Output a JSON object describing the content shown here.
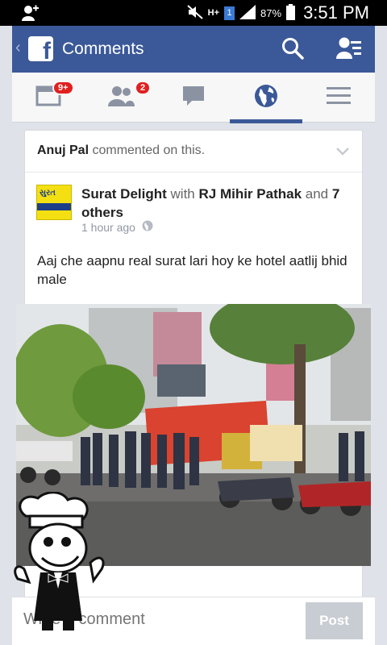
{
  "status_bar": {
    "network": "H+",
    "sim": "1",
    "battery": "87%",
    "time": "3:51 PM"
  },
  "app_bar": {
    "title": "Comments"
  },
  "tabs": [
    {
      "name": "feed",
      "badge": "9+"
    },
    {
      "name": "friend-requests",
      "badge": "2"
    },
    {
      "name": "messages",
      "badge": ""
    },
    {
      "name": "notifications",
      "badge": "",
      "active": true
    },
    {
      "name": "more",
      "badge": ""
    }
  ],
  "card": {
    "commenter": "Anuj Pal",
    "comment_action": " commented on this.",
    "post": {
      "page_name": "Surat Delight",
      "with_word": " with ",
      "tagged": "RJ Mihir Pathak",
      "and_word": " and ",
      "others": "7 others",
      "time": "1 hour ago",
      "text": "Aaj che aapnu real surat lari hoy ke hotel aatlij bhid male",
      "logo_text": "સુરત"
    }
  },
  "comment_bar": {
    "placeholder": "Write a comment",
    "post_label": "Post"
  },
  "colors": {
    "facebook_blue": "#3b5998",
    "badge_red": "#e0201f",
    "post_disabled": "#c8ccd3"
  }
}
